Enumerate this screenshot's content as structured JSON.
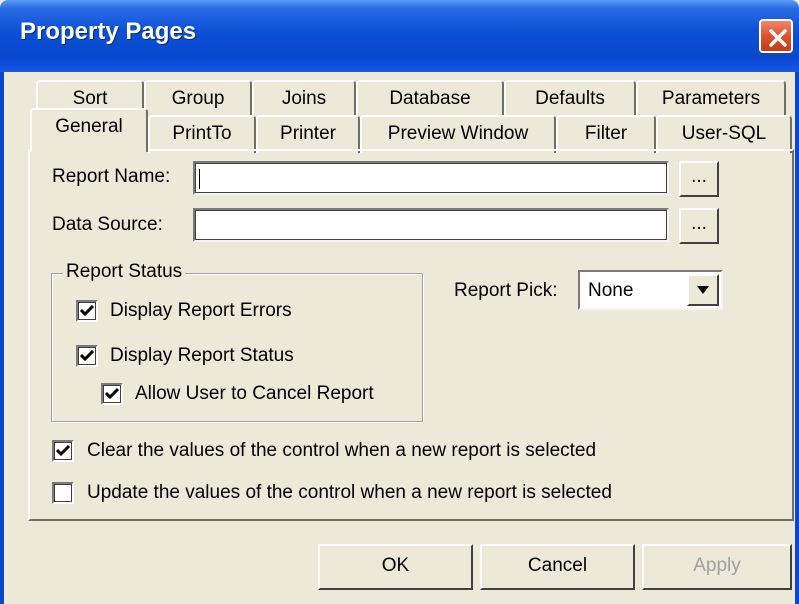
{
  "window": {
    "title": "Property Pages",
    "close_icon": "close-icon"
  },
  "tabs": {
    "row_back": [
      "Sort",
      "Group",
      "Joins",
      "Database",
      "Defaults",
      "Parameters"
    ],
    "row_front": [
      "General",
      "PrintTo",
      "Printer",
      "Preview Window",
      "Filter",
      "User-SQL"
    ],
    "active": "General"
  },
  "general": {
    "report_name_label": "Report Name:",
    "report_name_value": "",
    "data_source_label": "Data Source:",
    "data_source_value": "",
    "browse_label": "...",
    "report_status_group": "Report Status",
    "display_errors_label": "Display Report Errors",
    "display_errors_checked": true,
    "display_status_label": "Display Report Status",
    "display_status_checked": true,
    "allow_cancel_label": "Allow User to Cancel Report",
    "allow_cancel_checked": true,
    "report_pick_label": "Report Pick:",
    "report_pick_value": "None",
    "clear_values_label": "Clear the values of the control when a new report is selected",
    "clear_values_checked": true,
    "update_values_label": "Update the values of the control when a new report is selected",
    "update_values_checked": false
  },
  "buttons": {
    "ok": "OK",
    "cancel": "Cancel",
    "apply": "Apply"
  },
  "colors": {
    "titlebar": "#0948cc",
    "dialog_bg": "#ece9d8",
    "close_button": "#e0502c"
  }
}
